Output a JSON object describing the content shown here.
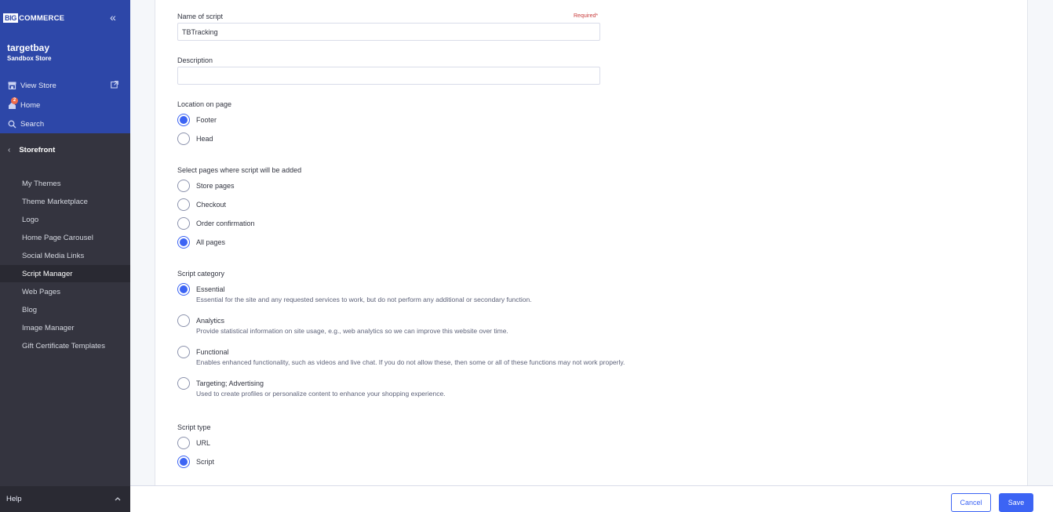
{
  "brand": {
    "logo_big": "BIG",
    "logo_commerce": "COMMERCE"
  },
  "sidebar": {
    "store_name": "targetbay",
    "store_subtitle": "Sandbox Store",
    "links": {
      "view_store": "View Store",
      "home": "Home",
      "home_badge": "2",
      "search": "Search"
    },
    "section_title": "Storefront",
    "menu": [
      "My Themes",
      "Theme Marketplace",
      "Logo",
      "Home Page Carousel",
      "Social Media Links",
      "Script Manager",
      "Web Pages",
      "Blog",
      "Image Manager",
      "Gift Certificate Templates"
    ],
    "active_item": "Script Manager",
    "help": "Help"
  },
  "form": {
    "name": {
      "label": "Name of script",
      "required": "Required*",
      "value": "TBTracking"
    },
    "description": {
      "label": "Description",
      "value": ""
    },
    "location": {
      "label": "Location on page",
      "options": [
        {
          "label": "Footer",
          "checked": true
        },
        {
          "label": "Head",
          "checked": false
        }
      ]
    },
    "pages": {
      "label": "Select pages where script will be added",
      "options": [
        {
          "label": "Store pages",
          "checked": false
        },
        {
          "label": "Checkout",
          "checked": false
        },
        {
          "label": "Order confirmation",
          "checked": false
        },
        {
          "label": "All pages",
          "checked": true
        }
      ]
    },
    "category": {
      "label": "Script category",
      "options": [
        {
          "label": "Essential",
          "desc": "Essential for the site and any requested services to work, but do not perform any additional or secondary function.",
          "checked": true
        },
        {
          "label": "Analytics",
          "desc": "Provide statistical information on site usage, e.g., web analytics so we can improve this website over time.",
          "checked": false
        },
        {
          "label": "Functional",
          "desc": "Enables enhanced functionality, such as videos and live chat. If you do not allow these, then some or all of these functions may not work properly.",
          "checked": false
        },
        {
          "label": "Targeting; Advertising",
          "desc": "Used to create profiles or personalize content to enhance your shopping experience.",
          "checked": false
        }
      ]
    },
    "type": {
      "label": "Script type",
      "options": [
        {
          "label": "URL",
          "checked": false
        },
        {
          "label": "Script",
          "checked": true
        }
      ]
    }
  },
  "footer": {
    "cancel": "Cancel",
    "save": "Save"
  },
  "colors": {
    "primary": "#3c64f4",
    "sidebar_top": "#2d47a8",
    "sidebar": "#34343f",
    "required": "#c83c3c"
  }
}
